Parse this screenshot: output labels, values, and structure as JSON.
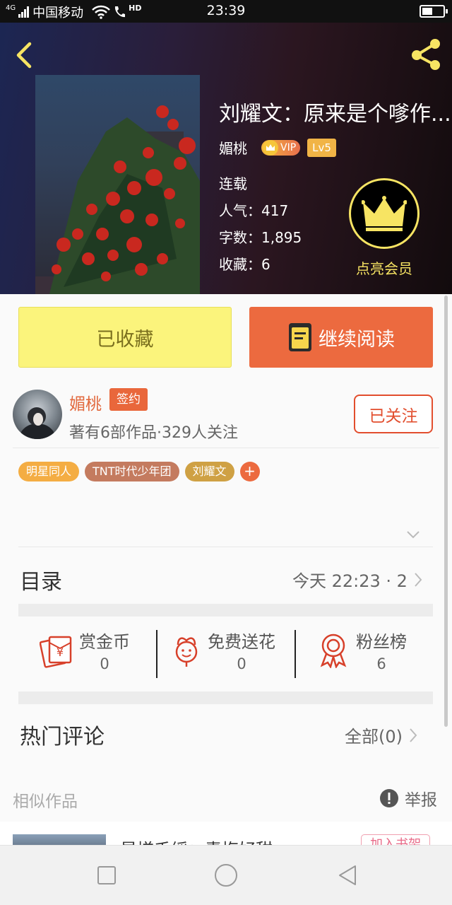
{
  "status_bar": {
    "network": "4G",
    "carrier": "中国移动",
    "hd": "HD",
    "time": "23:39"
  },
  "book": {
    "title": "刘耀文：原来是个嗲作...",
    "author": "媚桃",
    "vip_label": "VIP",
    "level": "Lv5",
    "status": "连载",
    "popularity_label": "人气：",
    "popularity": "417",
    "words_label": "字数：",
    "words": "1,895",
    "favorites_label": "收藏：",
    "favorites": "6",
    "member_label": "点亮会员"
  },
  "actions": {
    "favorited_label": "已收藏",
    "continue_label": "继续阅读"
  },
  "author_info": {
    "name": "媚桃",
    "sign_badge": "签约",
    "stats": "著有6部作品·329人关注",
    "follow_label": "已关注"
  },
  "tags": [
    {
      "label": "明星同人",
      "color": "#f4ad43"
    },
    {
      "label": "TNT时代少年团",
      "color": "#c47b5f"
    },
    {
      "label": "刘耀文",
      "color": "#cfa144"
    }
  ],
  "tag_add": "+",
  "catalog": {
    "title": "目录",
    "update": "今天 22:23 · 2"
  },
  "stats": [
    {
      "label": "赏金币",
      "value": "0",
      "icon": "red-envelope-icon"
    },
    {
      "label": "免费送花",
      "value": "0",
      "icon": "flower-icon"
    },
    {
      "label": "粉丝榜",
      "value": "6",
      "icon": "ribbon-medal-icon"
    }
  ],
  "comments": {
    "title": "热门评论",
    "all_label": "全部(0)"
  },
  "similar": {
    "label": "相似作品",
    "report_label": "举报",
    "first_title": "星槎千绥：青梅好甜",
    "add_shelf": "加入书架"
  },
  "colors": {
    "accent": "#ec6a3f",
    "favorite_yellow": "#fbf47c",
    "member_gold": "#f7e463"
  }
}
